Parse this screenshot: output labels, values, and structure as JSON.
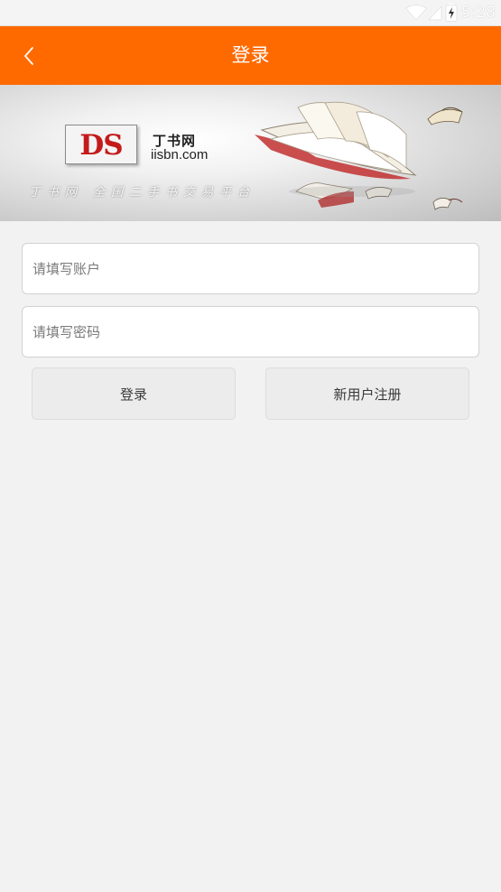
{
  "status_bar": {
    "time": "5:28",
    "icons": [
      "wifi-icon",
      "signal-icon",
      "battery-charging-icon"
    ]
  },
  "app_bar": {
    "title": "登录",
    "back_icon": "chevron-left-icon",
    "color": "#ff6a00"
  },
  "banner": {
    "logo_mark": "DS",
    "site_name": "丁书网",
    "domain": "iisbn.com",
    "slogan": "丁书网 全国二手书交易平台"
  },
  "form": {
    "account_placeholder": "请填写账户",
    "password_placeholder": "请填写密码",
    "account_value": "",
    "password_value": ""
  },
  "buttons": {
    "login": "登录",
    "register": "新用户注册"
  }
}
